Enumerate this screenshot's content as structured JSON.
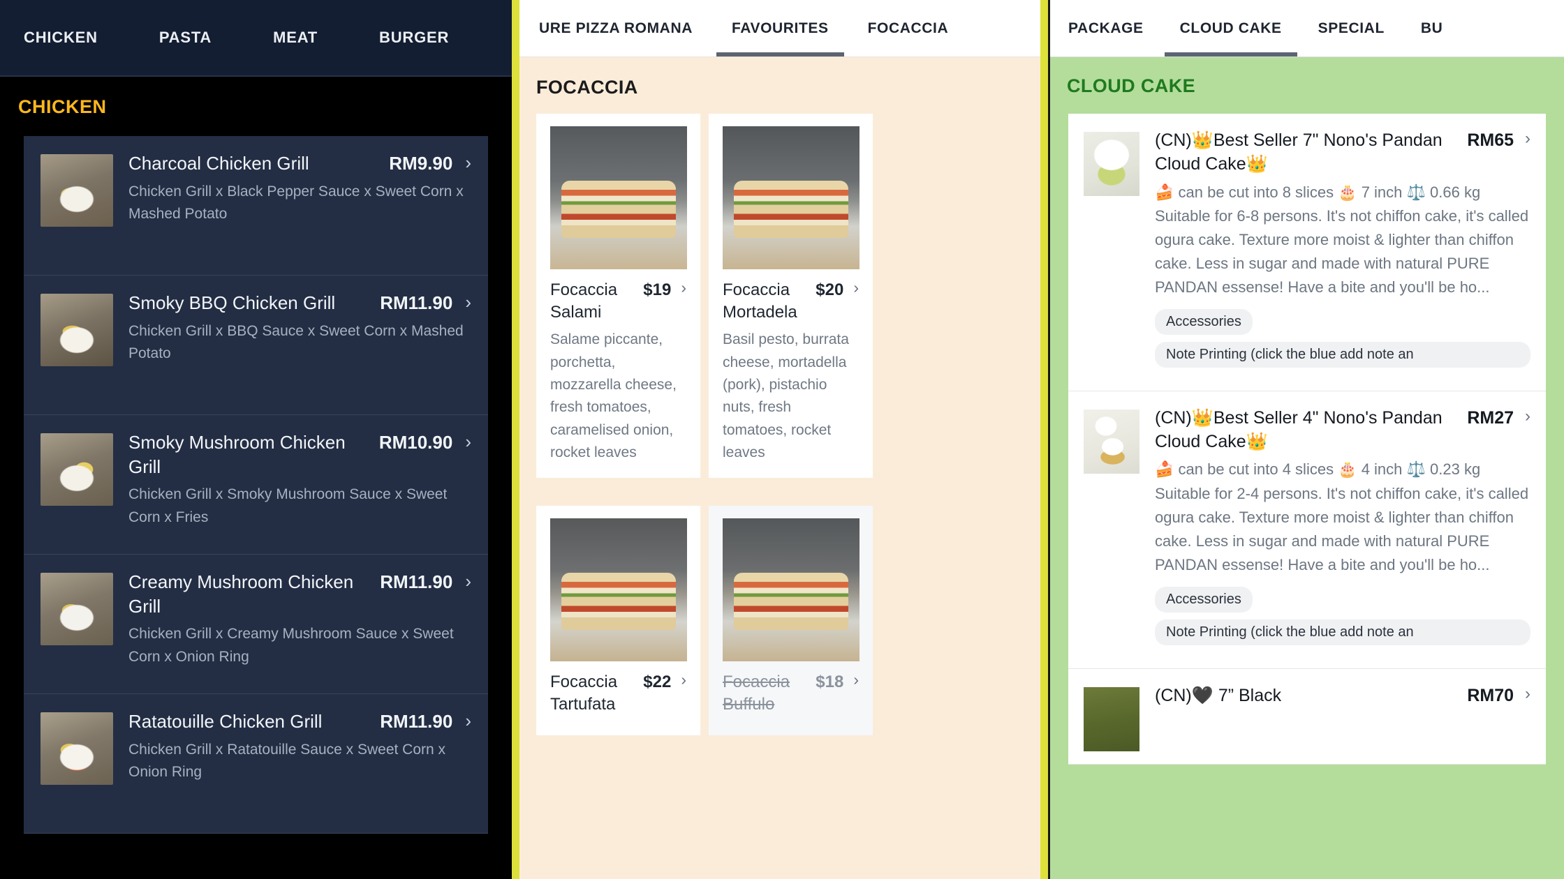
{
  "left_panel": {
    "theme_accent": "#ffb81c",
    "tabs": [
      {
        "label": "CHICKEN"
      },
      {
        "label": "PASTA"
      },
      {
        "label": "MEAT"
      },
      {
        "label": "BURGER"
      }
    ],
    "section_title": "CHICKEN",
    "items": [
      {
        "name": "Charcoal Chicken Grill",
        "price": "RM9.90",
        "desc": "Chicken Grill x Black Pepper Sauce x Sweet Corn x Mashed Potato",
        "chevron": "›"
      },
      {
        "name": "Smoky BBQ Chicken Grill",
        "price": "RM11.90",
        "desc": "Chicken Grill x BBQ Sauce x Sweet Corn x Mashed Potato",
        "chevron": "›"
      },
      {
        "name": "Smoky Mushroom Chicken Grill",
        "price": "RM10.90",
        "desc": "Chicken Grill x Smoky Mushroom Sauce x Sweet Corn x Fries",
        "chevron": "›"
      },
      {
        "name": "Creamy Mushroom Chicken Grill",
        "price": "RM11.90",
        "desc": "Chicken Grill x Creamy Mushroom Sauce x Sweet Corn x Onion Ring",
        "chevron": "›"
      },
      {
        "name": "Ratatouille Chicken Grill",
        "price": "RM11.90",
        "desc": "Chicken Grill x Ratatouille Sauce x Sweet Corn x Onion Ring",
        "chevron": "›"
      }
    ]
  },
  "middle_panel": {
    "theme_accent": "#dde13a",
    "background": "#fbecda",
    "tabs": [
      {
        "label": "URE PIZZA ROMANA",
        "active": false
      },
      {
        "label": "FAVOURITES",
        "active": true
      },
      {
        "label": "FOCACCIA",
        "active": false
      }
    ],
    "section_title": "FOCACCIA",
    "cards": [
      {
        "name": "Focaccia Salami",
        "price": "$19",
        "desc": "Salame piccante, porchetta, mozzarella cheese, fresh tomatoes, caramelised onion, rocket leaves",
        "chevron": "›",
        "sold_out": false
      },
      {
        "name": "Focaccia Mortadela",
        "price": "$20",
        "desc": "Basil pesto, burrata cheese, mortadella (pork), pistachio nuts, fresh tomatoes, rocket leaves",
        "chevron": "›",
        "sold_out": false
      },
      {
        "name": "Focaccia Tartufata",
        "price": "$22",
        "desc": "",
        "chevron": "›",
        "sold_out": false
      },
      {
        "name": "Focaccia Buffulo",
        "price": "$18",
        "desc": "",
        "chevron": "›",
        "sold_out": true
      }
    ]
  },
  "right_panel": {
    "theme_accent": "#1e7a1e",
    "background": "#b4dd9c",
    "tabs": [
      {
        "label": "PACKAGE",
        "active": false
      },
      {
        "label": "CLOUD CAKE",
        "active": true
      },
      {
        "label": "SPECIAL",
        "active": false
      },
      {
        "label": "BU",
        "active": false
      }
    ],
    "section_title": "CLOUD CAKE",
    "items": [
      {
        "name": "(CN)👑Best Seller 7\" Nono's Pandan Cloud Cake👑",
        "price": "RM65",
        "desc": "🍰 can be cut into 8 slices 🎂 7 inch ⚖️ 0.66 kg Suitable for 6-8 persons. It's not chiffon cake, it's called ogura cake. Texture more moist & lighter than chiffon cake. Less in sugar and made with natural PURE PANDAN essense! Have a bite and you'll be ho...",
        "chevron": "›",
        "tags": [
          "Accessories",
          "Note Printing (click the blue add note an"
        ]
      },
      {
        "name": "(CN)👑Best Seller 4\" Nono's Pandan Cloud Cake👑",
        "price": "RM27",
        "desc": "🍰 can be cut into 4 slices 🎂 4 inch ⚖️ 0.23 kg Suitable for 2-4 persons. It's not chiffon cake, it's called ogura cake. Texture more moist & lighter than chiffon cake. Less in sugar and made with natural PURE PANDAN essense! Have a bite and you'll be ho...",
        "chevron": "›",
        "tags": [
          "Accessories",
          "Note Printing (click the blue add note an"
        ]
      },
      {
        "name": "(CN)🖤 7” Black",
        "price": "RM70",
        "desc": "",
        "chevron": "›",
        "tags": []
      }
    ]
  }
}
